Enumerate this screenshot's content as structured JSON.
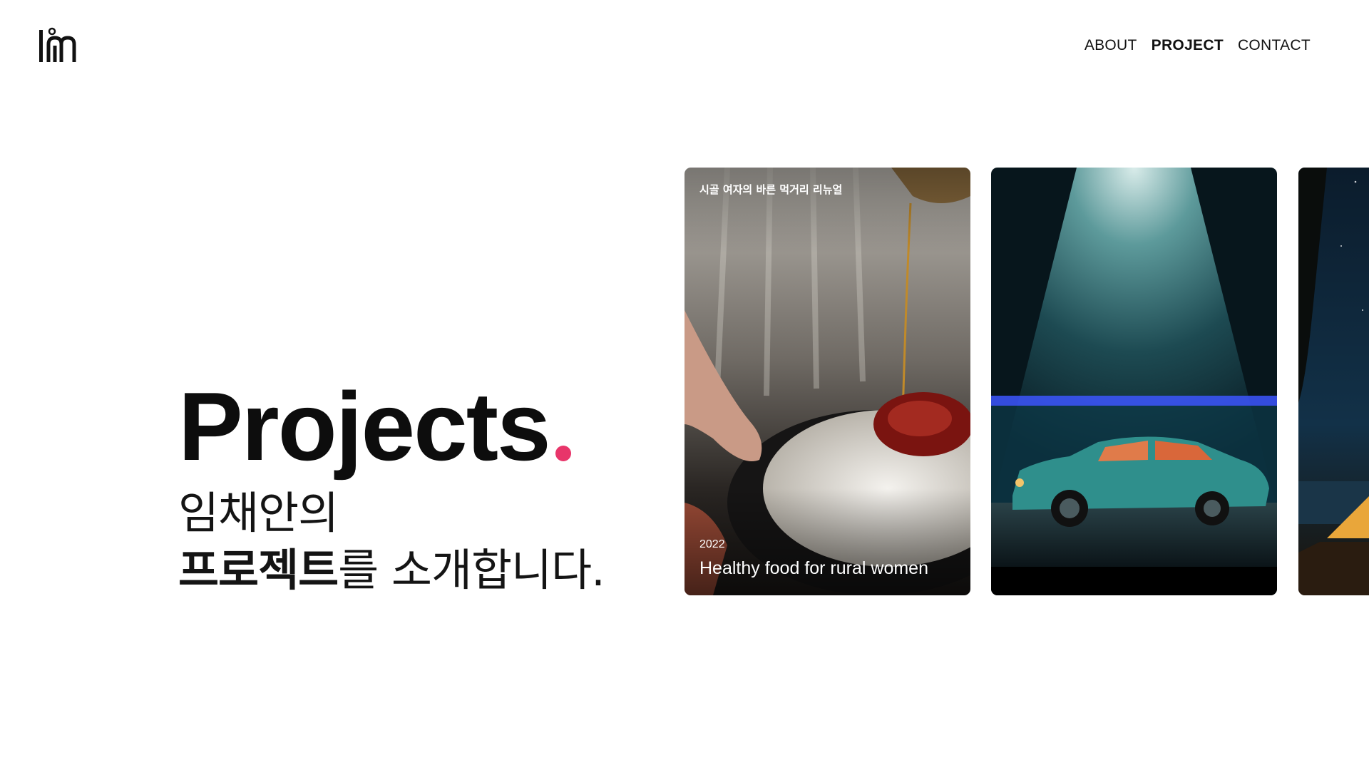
{
  "header": {
    "logo_icon": "im-logo",
    "nav": [
      {
        "label": "ABOUT",
        "active": false
      },
      {
        "label": "PROJECT",
        "active": true
      },
      {
        "label": "CONTACT",
        "active": false
      }
    ]
  },
  "hero": {
    "title": "Projects",
    "dot_color": "#e8356a",
    "subtitle_line1": "임채안의",
    "subtitle_line2_bold": "프로젝트",
    "subtitle_line2_rest": "를 소개합니다."
  },
  "cards": [
    {
      "caption": "시골 여자의 바른 먹거리 리뉴얼",
      "year": "2022",
      "title": "Healthy food for rural women",
      "image": "food-rice-syrup-photo"
    },
    {
      "image": "car-in-light-beam-photo"
    },
    {
      "image": "night-tent-photo"
    }
  ]
}
